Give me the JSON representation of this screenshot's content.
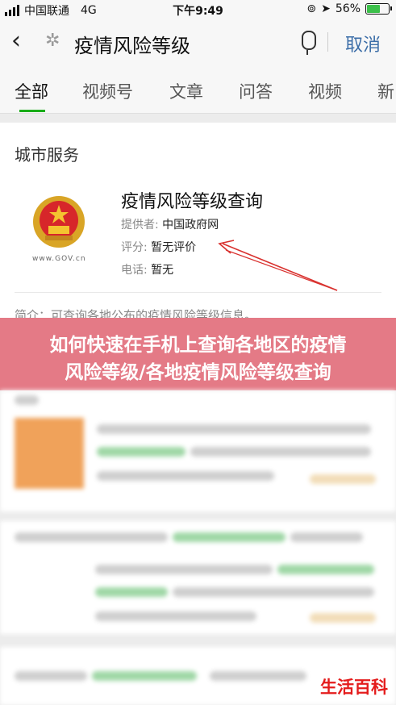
{
  "status_bar": {
    "carrier": "中国联通",
    "network": "4G",
    "time": "下午9:49",
    "battery_percent": "56%",
    "battery_level": 0.56
  },
  "search": {
    "query": "疫情风险等级",
    "cancel_label": "取消"
  },
  "tabs": [
    {
      "label": "全部",
      "active": true
    },
    {
      "label": "视频号"
    },
    {
      "label": "文章"
    },
    {
      "label": "问答"
    },
    {
      "label": "视频"
    },
    {
      "label": "新"
    }
  ],
  "service_section": {
    "title": "城市服务",
    "logo_caption": "www.GOV.cn",
    "service_title": "疫情风险等级查询",
    "provider_label": "提供者:",
    "provider_value": "中国政府网",
    "rating_label": "评分:",
    "rating_value": "暂无评价",
    "phone_label": "电话:",
    "phone_value": "暂无",
    "summary": "简介：可查询各地公布的疫情风险等级信息。"
  },
  "banner": {
    "line1": "如何快速在手机上查询各地区的疫情",
    "line2": "风险等级/各地疫情风险等级查询"
  },
  "watermark": "生活百科",
  "colors": {
    "accent_green": "#1aad19",
    "cancel_blue": "#3c6ea8",
    "banner_pink": "#e47a86",
    "watermark_red": "#e41c1c",
    "arrow_red": "#d9322f"
  }
}
